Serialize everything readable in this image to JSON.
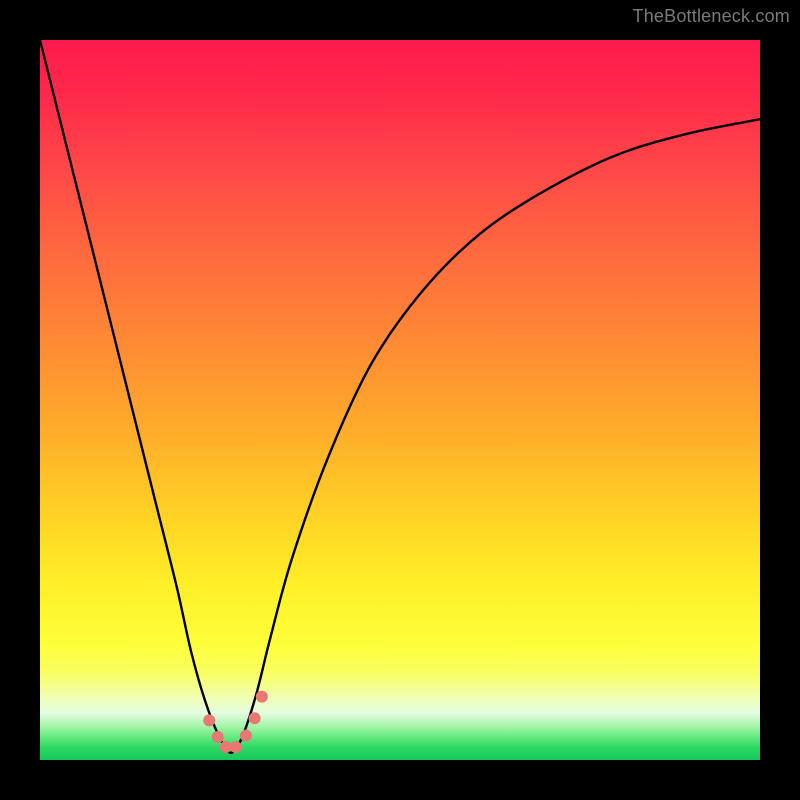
{
  "watermark": "TheBottleneck.com",
  "chart_data": {
    "type": "line",
    "title": "",
    "xlabel": "",
    "ylabel": "",
    "xlim": [
      0,
      100
    ],
    "ylim": [
      0,
      100
    ],
    "grid": false,
    "legend": false,
    "background_gradient_stops": [
      {
        "pct": 0,
        "color": "#ff1a4f"
      },
      {
        "pct": 30,
        "color": "#ff6a3e"
      },
      {
        "pct": 66,
        "color": "#ffd224"
      },
      {
        "pct": 88,
        "color": "#f8ff62"
      },
      {
        "pct": 95.5,
        "color": "#9df5a3"
      },
      {
        "pct": 100,
        "color": "#16c95a"
      }
    ],
    "series": [
      {
        "name": "bottleneck-curve",
        "x": [
          0,
          5,
          10,
          13,
          16,
          19,
          21,
          23,
          25,
          26.5,
          28,
          30,
          32,
          35,
          40,
          46,
          53,
          61,
          70,
          80,
          90,
          100
        ],
        "y": [
          100,
          80,
          60,
          48,
          36,
          24,
          15,
          8,
          3,
          1,
          3,
          9,
          17,
          28,
          42,
          55,
          65,
          73,
          79,
          84,
          87,
          89
        ]
      }
    ],
    "markers": [
      {
        "name": "dot-1",
        "x": 23.5,
        "y": 5.5
      },
      {
        "name": "dot-2",
        "x": 24.7,
        "y": 3.2
      },
      {
        "name": "dot-3",
        "x": 25.8,
        "y": 1.8
      },
      {
        "name": "dot-4",
        "x": 27.2,
        "y": 1.8
      },
      {
        "name": "dot-5",
        "x": 28.6,
        "y": 3.4
      },
      {
        "name": "dot-6",
        "x": 29.8,
        "y": 5.8
      },
      {
        "name": "dot-7",
        "x": 30.8,
        "y": 8.8
      }
    ],
    "marker_color": "#e77874",
    "curve_color": "#000000"
  }
}
